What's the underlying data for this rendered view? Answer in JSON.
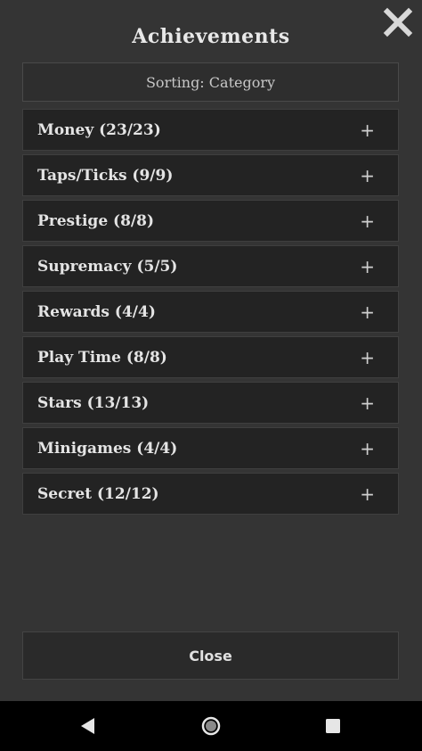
{
  "title": "Achievements",
  "sorting_label": "Sorting: Category",
  "categories": [
    {
      "label": "Money (23/23)",
      "toggle": "+"
    },
    {
      "label": "Taps/Ticks (9/9)",
      "toggle": "+"
    },
    {
      "label": "Prestige (8/8)",
      "toggle": "+"
    },
    {
      "label": "Supremacy (5/5)",
      "toggle": "+"
    },
    {
      "label": "Rewards (4/4)",
      "toggle": "+"
    },
    {
      "label": "Play Time (8/8)",
      "toggle": "+"
    },
    {
      "label": "Stars (13/13)",
      "toggle": "+"
    },
    {
      "label": "Minigames (4/4)",
      "toggle": "+"
    },
    {
      "label": "Secret (12/12)",
      "toggle": "+"
    }
  ],
  "close_label": "Close",
  "icons": {
    "dismiss": "close-icon",
    "back": "back-triangle-icon",
    "home": "home-circle-icon",
    "recents": "recents-square-icon"
  },
  "colors": {
    "background": "#343434",
    "row_background": "#232323",
    "navbar": "#000000",
    "text": "#e4e4e4"
  }
}
